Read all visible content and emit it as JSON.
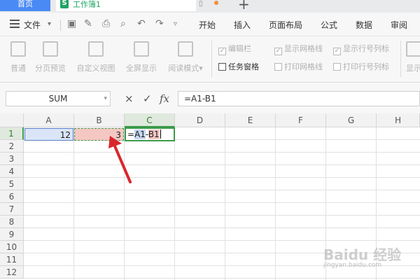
{
  "tabs": {
    "home_label": "首页",
    "doc_icon_letter": "S",
    "doc_name": "工作簿1"
  },
  "menu": {
    "file_label": "文件",
    "items": [
      "开始",
      "插入",
      "页面布局",
      "公式",
      "数据",
      "审阅"
    ]
  },
  "ribbon": {
    "buttons": [
      "普通",
      "分页预览",
      "自定义视图",
      "全屏显示",
      "阅读模式"
    ],
    "checkboxes_row1": [
      {
        "label": "编辑栏",
        "checked": true
      },
      {
        "label": "显示网格线",
        "checked": true
      },
      {
        "label": "显示行号列标",
        "checked": true
      }
    ],
    "checkboxes_row2": [
      {
        "label": "任务窗格",
        "checked": false
      },
      {
        "label": "打印网格线",
        "checked": false
      },
      {
        "label": "打印行号列标",
        "checked": false
      }
    ],
    "truncated_right_label": "显示"
  },
  "formula_bar": {
    "name_box": "SUM",
    "cancel_symbol": "×",
    "enter_symbol": "✓",
    "fx_symbol": "fx",
    "formula": "=A1-B1"
  },
  "grid": {
    "columns": [
      "A",
      "B",
      "C",
      "D",
      "E",
      "F",
      "G",
      "H"
    ],
    "selected_column": "C",
    "rows": [
      "1",
      "2",
      "3",
      "4",
      "5",
      "6",
      "7",
      "8",
      "9",
      "10",
      "11",
      "12"
    ],
    "selected_row": "1",
    "cells": {
      "A1": "12",
      "B1": "3",
      "C1_eq": "=",
      "C1_ref1": "A1",
      "C1_op": "-",
      "C1_ref2": "B1"
    }
  },
  "watermark": {
    "text": "Baidu 经验",
    "url": "jingyan.baidu.com"
  },
  "colors": {
    "accent_green": "#3c9b4a",
    "home_tab_blue": "#4a8af4",
    "ref_a1_fill": "#dae5f7",
    "ref_b1_fill": "#f4c7c3",
    "arrow_red": "#d9262c"
  }
}
